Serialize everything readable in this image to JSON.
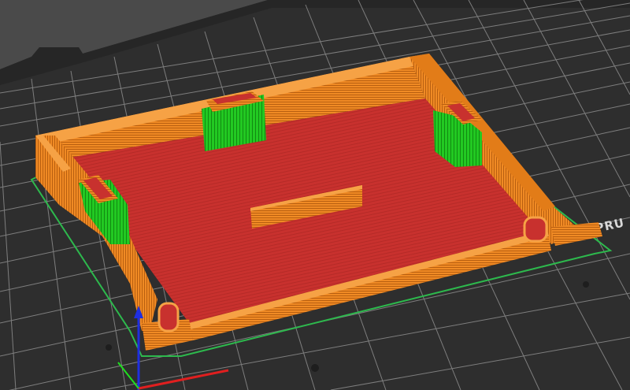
{
  "viewport": {
    "bed_label": "PRU",
    "view": "sliced-preview-3d"
  },
  "colors": {
    "background": "#4a4a4a",
    "bed_surface": "#2e2e2e",
    "grid_line": "#8c8c8c",
    "perimeter": "#f08a24",
    "infill": "#c8312e",
    "support": "#22c922",
    "skirt": "#2db94d",
    "axis_z": "#1f2fe0",
    "axis_x": "#e01f1f",
    "axis_y": "#1fe01f"
  },
  "icons": {
    "axis_z": "z-axis-arrow-icon",
    "axis_x": "x-axis-arrow-icon",
    "axis_y": "y-axis-arrow-icon"
  }
}
